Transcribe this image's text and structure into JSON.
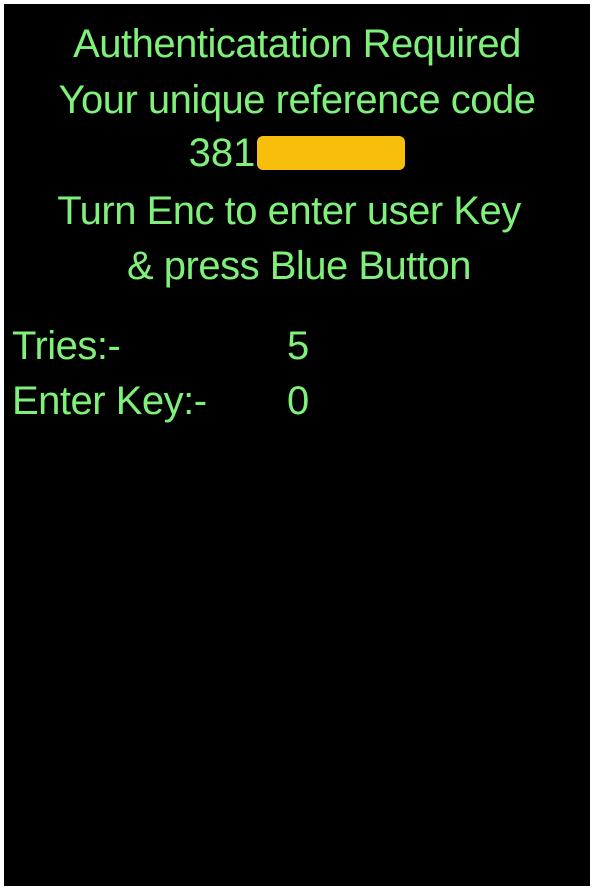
{
  "colors": {
    "text": "#7ff07a",
    "background": "#000000",
    "redaction": "#f7bf0b"
  },
  "display": {
    "title": "Authenticatation Required",
    "reference_label": "Your unique reference code",
    "reference_code_visible": "381",
    "instruction_line1": "Turn Enc to enter user Key",
    "instruction_line2": "& press Blue Button",
    "fields": [
      {
        "label": "Tries:-",
        "value": "5"
      },
      {
        "label": "Enter Key:-",
        "value": "0"
      }
    ]
  }
}
